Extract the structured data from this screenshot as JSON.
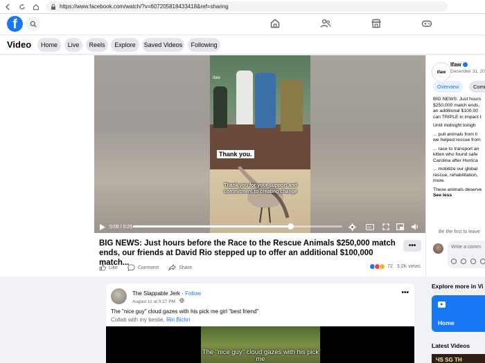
{
  "browser": {
    "url": "https://www.facebook.com/watch/?v=607205818433418&ref=sharing"
  },
  "nav": {
    "icons": [
      "home-icon",
      "friends-icon",
      "marketplace-icon",
      "gaming-icon"
    ]
  },
  "videobar": {
    "title": "Video",
    "pills": [
      "Home",
      "Live",
      "Reels",
      "Explore",
      "Saved Videos",
      "Following"
    ]
  },
  "player": {
    "watermark": "ifaw",
    "caption_box": "Thank you.",
    "caption_sub": "Thank you for your support and commitment to creating change",
    "time": "0:09 / 0:25",
    "progress_fraction": 0.75
  },
  "post": {
    "title": "BIG NEWS: Just hours before the Race to the Rescue Animals $250,000 match ends, our friends at David Rio stepped up to offer an additional $100,000 match...",
    "more": "•••",
    "actions": [
      "Like",
      "Comment",
      "Share"
    ],
    "reaction_count": "72",
    "views": "3.2K views"
  },
  "post2": {
    "author": "The Slappable Jerk",
    "follow": "Follow",
    "date": "August 11 at 9:17 PM ·",
    "text": "The \"nice guy\" cloud gazes with his pick me girl \"best friend\"",
    "collab_prefix": "Collab with my bestie, ",
    "collab_name": "Riri Bichri",
    "video_caption": "The \"nice guy\" cloud gazes with his pick me",
    "dots": "•••"
  },
  "right": {
    "logo": "ifaw",
    "name": "Ifaw",
    "date": "December 31, 20",
    "tabs": [
      "Overview",
      "Comm"
    ],
    "desc": [
      "BIG NEWS: Just hours",
      "$250,000 match ends,",
      "an additional $100,00",
      "can TRIPLE in impact t"
    ],
    "desc2": "Until midnight tonigh",
    "desc3": [
      "... pull animals from li",
      "we helped rescue from"
    ],
    "desc4": [
      "... race to transport an",
      "kitten who found safe",
      "Carolina after Hurrica"
    ],
    "desc5": [
      "... mobilize our global",
      "rescue, rehabilitation,",
      "more."
    ],
    "desc6": "These animals deserve",
    "see_less": "See less",
    "first_comment": "Be the first to leave",
    "comment_placeholder": "Write a comm",
    "explore_title": "Explore more in Vi",
    "home_label": "Home",
    "latest_title": "Latest Videos",
    "latest_thumb_text": "ЧS SG TH"
  },
  "colors": {
    "brand": "#1877f2",
    "background": "#f0f2f5"
  }
}
